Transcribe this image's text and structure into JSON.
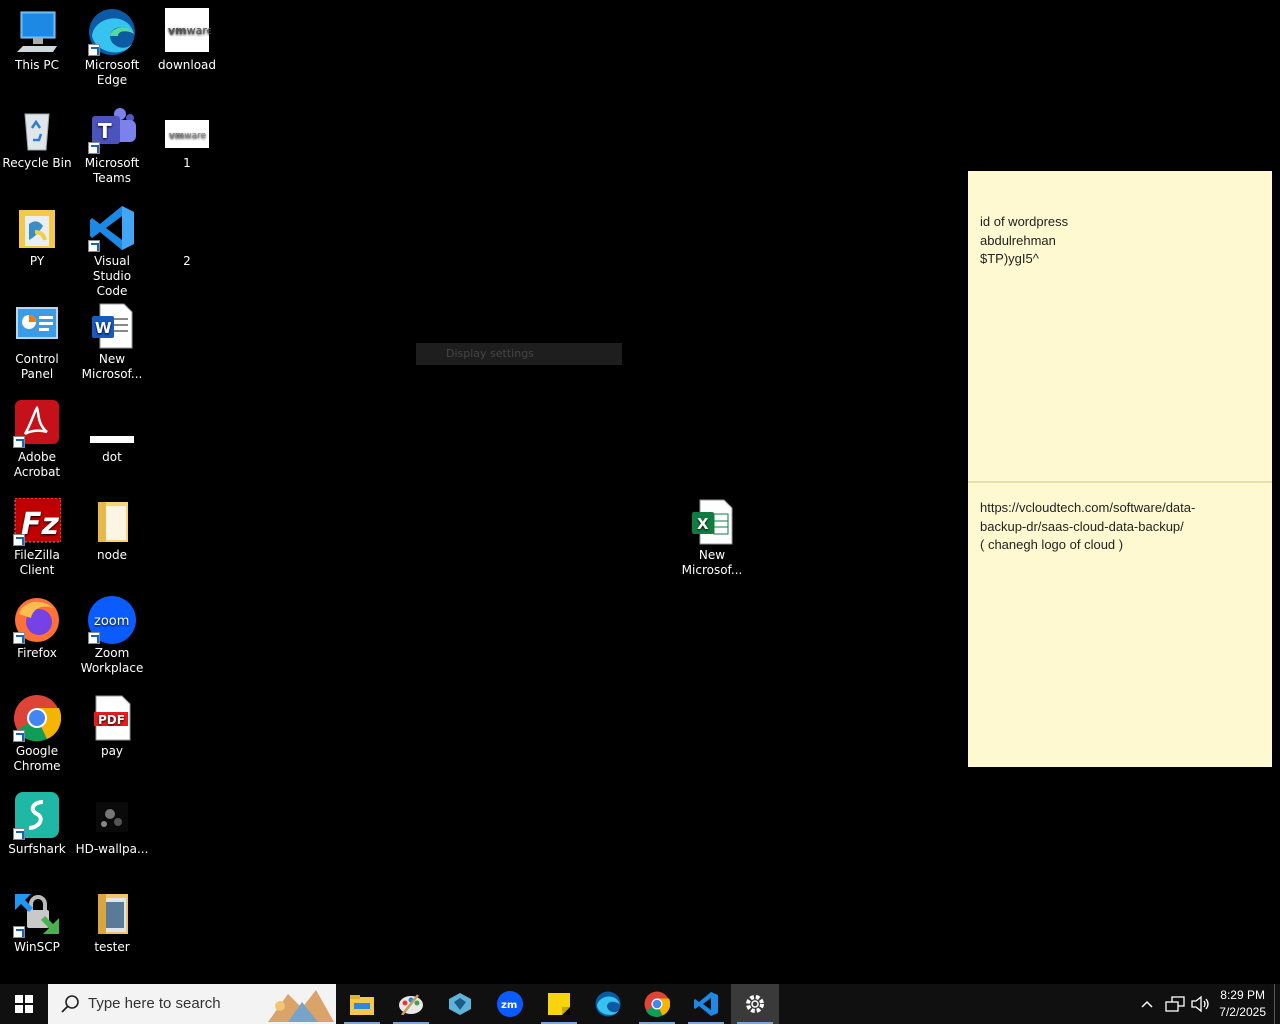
{
  "desktop": {
    "icons": [
      {
        "label": "This PC",
        "icon": "this-pc-icon"
      },
      {
        "label": "Microsoft\nEdge",
        "icon": "edge-icon"
      },
      {
        "label": "download",
        "icon": "vmware-image-icon"
      },
      {
        "label": "Recycle Bin",
        "icon": "recycle-bin-icon"
      },
      {
        "label": "Microsoft\nTeams",
        "icon": "teams-icon"
      },
      {
        "label": "1",
        "icon": "vmware-image-icon"
      },
      {
        "label": "PY",
        "icon": "folder-icon"
      },
      {
        "label": "Visual Studio\nCode",
        "icon": "vscode-icon"
      },
      {
        "label": "2",
        "icon": "blank-image-icon"
      },
      {
        "label": "Control\nPanel",
        "icon": "control-panel-icon"
      },
      {
        "label": "New\nMicrosof...",
        "icon": "word-doc-icon"
      },
      {
        "label": "Adobe\nAcrobat",
        "icon": "acrobat-icon"
      },
      {
        "label": "dot",
        "icon": "image-icon"
      },
      {
        "label": "FileZilla\nClient",
        "icon": "filezilla-icon"
      },
      {
        "label": "node",
        "icon": "folder-icon"
      },
      {
        "label": "Firefox",
        "icon": "firefox-icon"
      },
      {
        "label": "Zoom\nWorkplace",
        "icon": "zoom-icon"
      },
      {
        "label": "Google\nChrome",
        "icon": "chrome-icon"
      },
      {
        "label": "pay",
        "icon": "pdf-icon"
      },
      {
        "label": "Surfshark",
        "icon": "surfshark-icon"
      },
      {
        "label": "HD-wallpa...",
        "icon": "wallpaper-image-icon"
      },
      {
        "label": "WinSCP",
        "icon": "winscp-icon"
      },
      {
        "label": "tester",
        "icon": "folder-icon"
      },
      {
        "label": "New\nMicrosof...",
        "icon": "excel-icon"
      }
    ],
    "vmware_text": "vm",
    "vmware_text2": "ware",
    "zoom_text": "zoom",
    "pdf_text": "PDF"
  },
  "tooltip": {
    "text": "Display settings"
  },
  "sticky_notes": [
    {
      "lines": [
        "id of wordpress",
        "abdulrehman",
        "$TP)ygI5^"
      ]
    },
    {
      "lines": [
        "https://vcloudtech.com/software/data-",
        "backup-dr/saas-cloud-data-backup/",
        "( chanegh logo of cloud )"
      ]
    }
  ],
  "taskbar": {
    "search_placeholder": "Type here to search",
    "apps": [
      "file-explorer-icon",
      "paint-icon",
      "app-diamond-icon",
      "zoom-icon",
      "sticky-notes-icon",
      "edge-icon",
      "chrome-icon",
      "vscode-icon",
      "settings-icon"
    ],
    "time": "8:29 PM",
    "date": "7/2/2025"
  },
  "colors": {
    "taskbar": "#101010",
    "note": "#fff9d1",
    "accent": "#7aa7d8"
  }
}
